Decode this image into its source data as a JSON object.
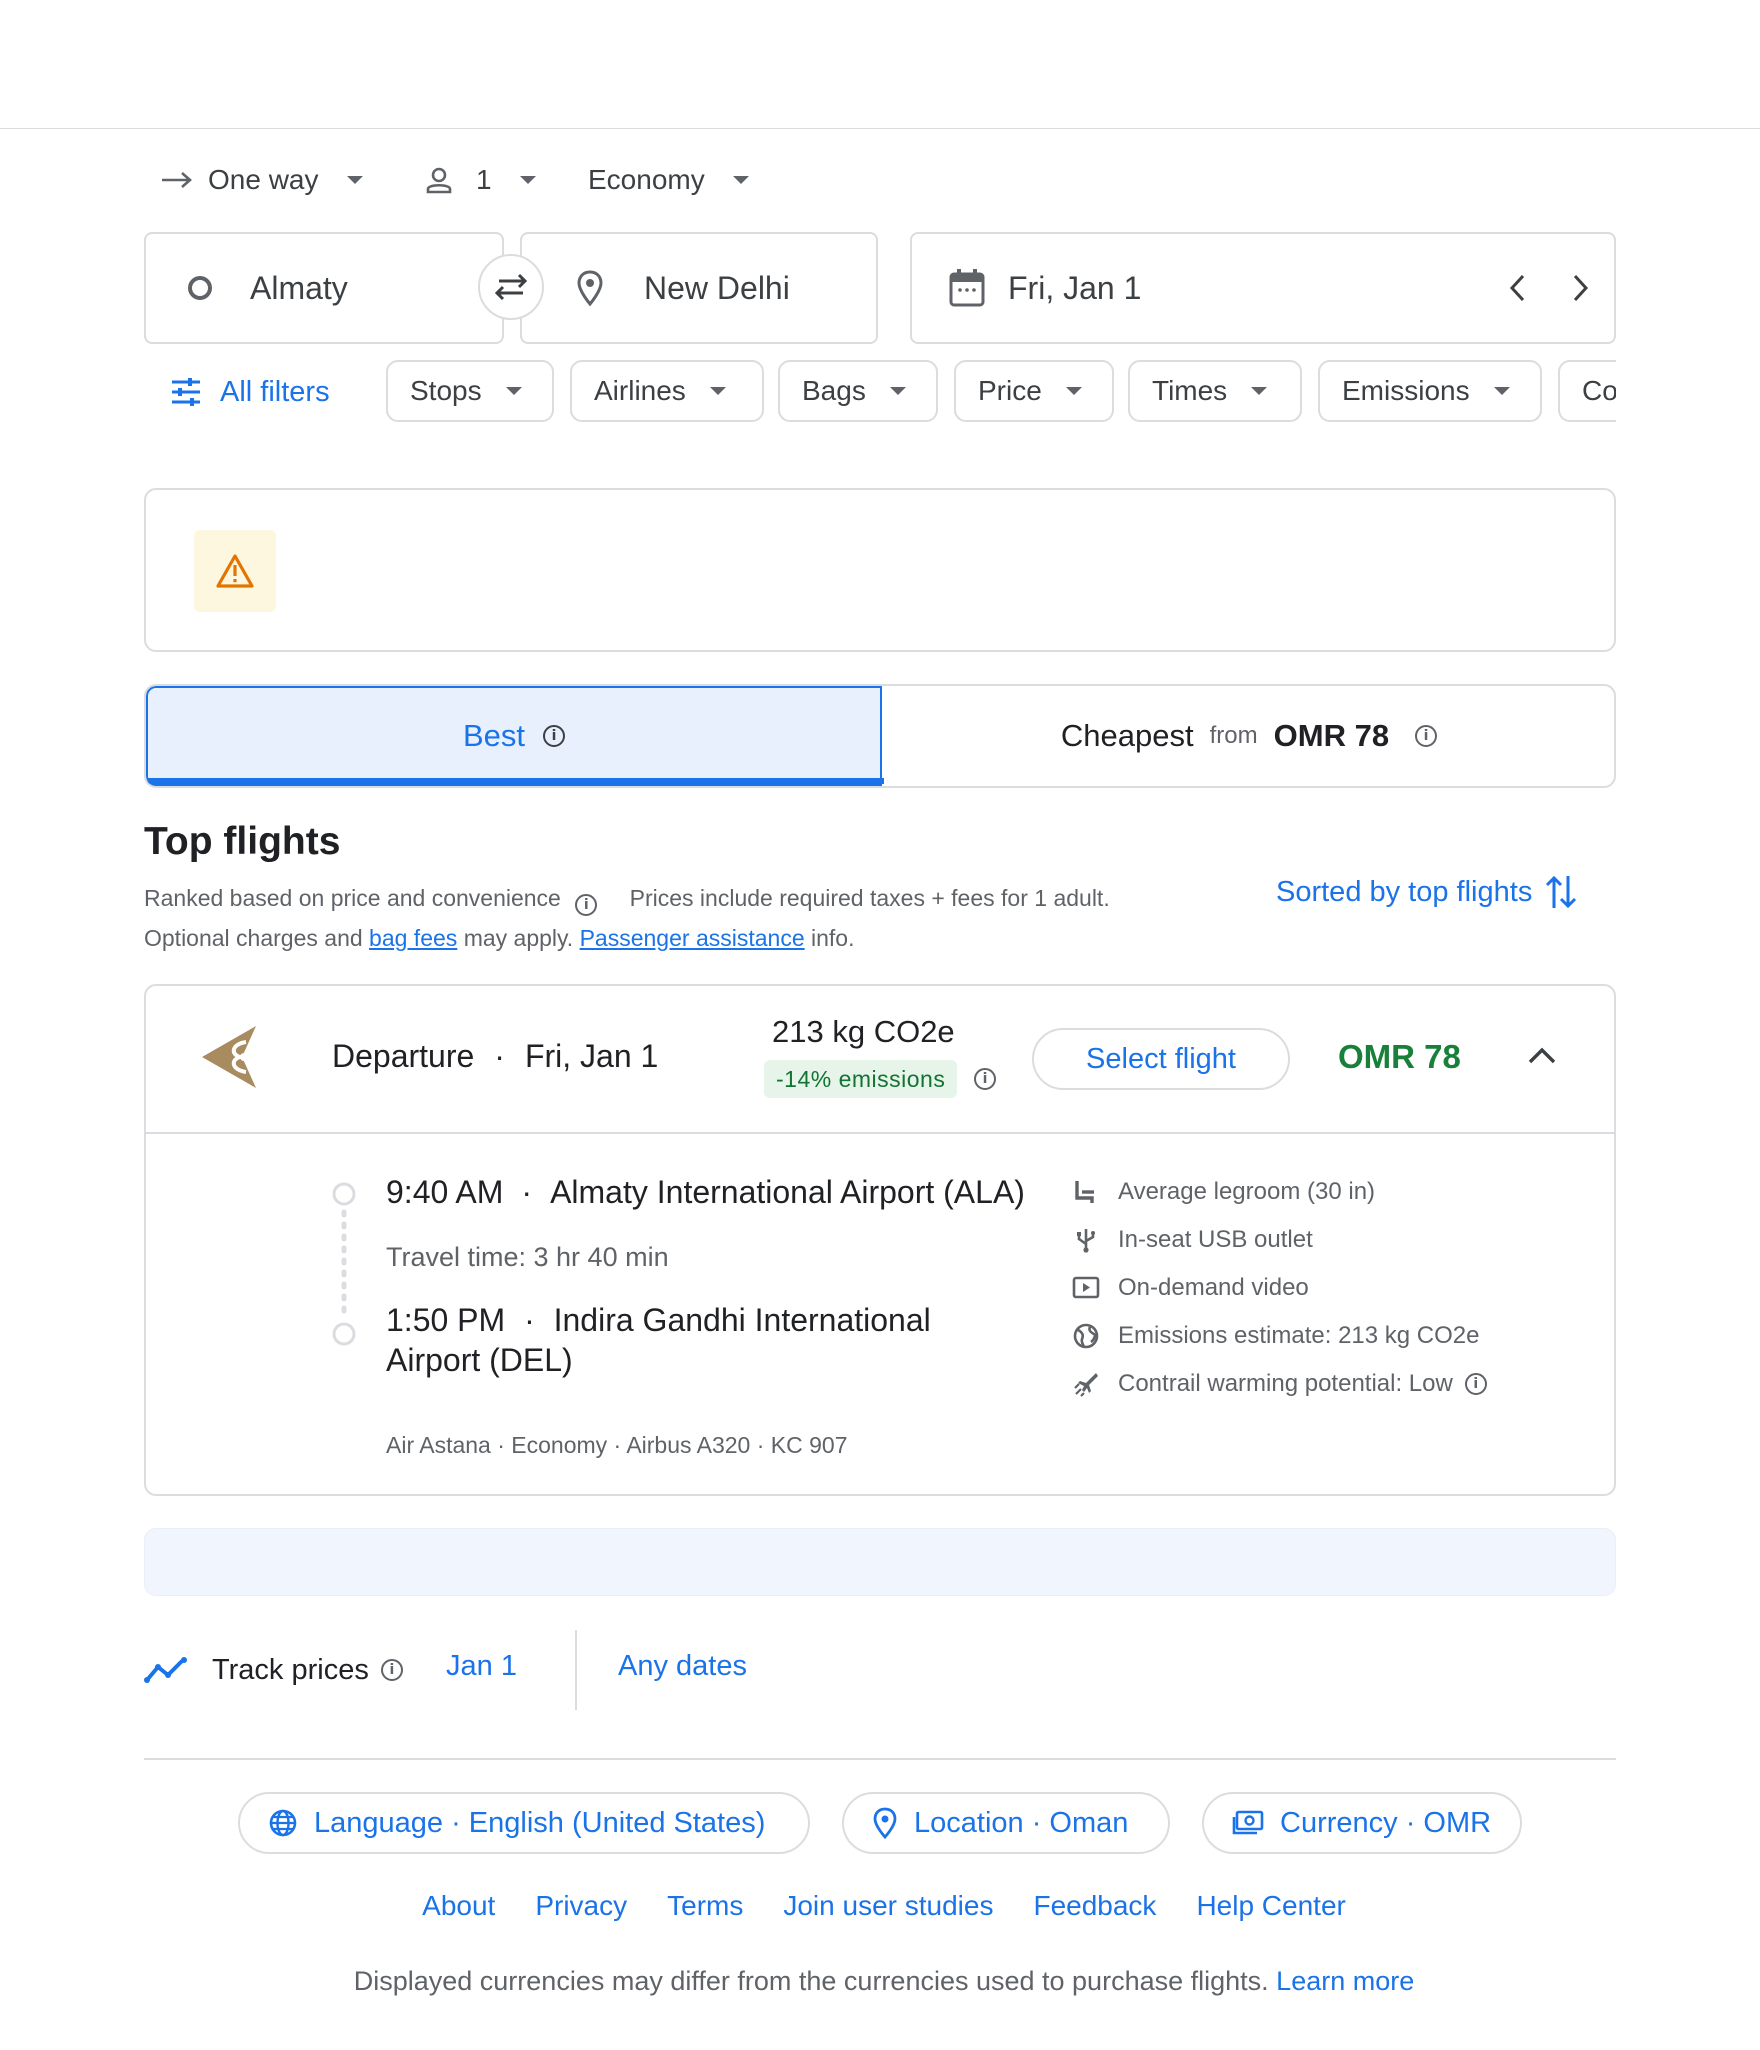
{
  "search": {
    "trip_type": "One way",
    "passengers": "1",
    "cabin": "Economy",
    "origin": "Almaty",
    "destination": "New Delhi",
    "date": "Fri, Jan 1"
  },
  "filters": {
    "all_filters": "All filters",
    "chips": [
      "Stops",
      "Airlines",
      "Bags",
      "Price",
      "Times",
      "Emissions",
      "Co"
    ]
  },
  "tabs": {
    "best": "Best",
    "cheapest": "Cheapest",
    "cheapest_from": "from",
    "cheapest_price": "OMR 78"
  },
  "results": {
    "title": "Top flights",
    "ranked_note": "Ranked based on price and convenience",
    "prices_note": "Prices include required taxes + fees for 1 adult.",
    "optional_charges": "Optional charges and",
    "bag_fees": "bag fees",
    "may_apply": "may apply.",
    "passenger_assistance": "Passenger assistance",
    "info_suffix": "info.",
    "sort_label": "Sorted by top flights"
  },
  "flight": {
    "departure_label": "Departure",
    "date": "Fri, Jan 1",
    "emissions": "213 kg CO2e",
    "emissions_delta": "-14% emissions",
    "select_label": "Select flight",
    "price": "OMR 78",
    "dep_time": "9:40 AM",
    "dep_airport": "Almaty International Airport (ALA)",
    "travel_time": "Travel time: 3 hr 40 min",
    "arr_time": "1:50 PM",
    "arr_airport": "Indira Gandhi International Airport (DEL)",
    "details": "Air Astana · Economy · Airbus A320 · KC 907",
    "amenities": [
      "Average legroom (30 in)",
      "In-seat USB outlet",
      "On-demand video",
      "Emissions estimate: 213 kg CO2e",
      "Contrail warming potential: Low"
    ]
  },
  "track": {
    "label": "Track prices",
    "date": "Jan 1",
    "any_dates": "Any dates"
  },
  "footer": {
    "language": "Language · English (United States)",
    "location": "Location · Oman",
    "currency": "Currency · OMR",
    "links": [
      "About",
      "Privacy",
      "Terms",
      "Join user studies",
      "Feedback",
      "Help Center"
    ],
    "disclaimer": "Displayed currencies may differ from the currencies used to purchase flights.",
    "learn_more": "Learn more"
  },
  "colors": {
    "accent": "#1a73e8",
    "price_green": "#188038",
    "emissions_bg": "#e6f4ea",
    "tab_active_bg": "#e8f0fe",
    "warning": "#e37400",
    "airline_logo": "#a88b5f"
  },
  "icons": [
    "arrow-right-icon",
    "person-icon",
    "circle-icon",
    "swap-icon",
    "location-pin-icon",
    "calendar-icon",
    "chevron-left-icon",
    "chevron-right-icon",
    "tune-icon",
    "warning-icon",
    "info-icon",
    "sort-icon",
    "airline-logo-icon",
    "chevron-up-icon",
    "legroom-icon",
    "usb-icon",
    "video-icon",
    "globe-icon",
    "contrail-icon",
    "trending-icon",
    "currency-icon"
  ]
}
